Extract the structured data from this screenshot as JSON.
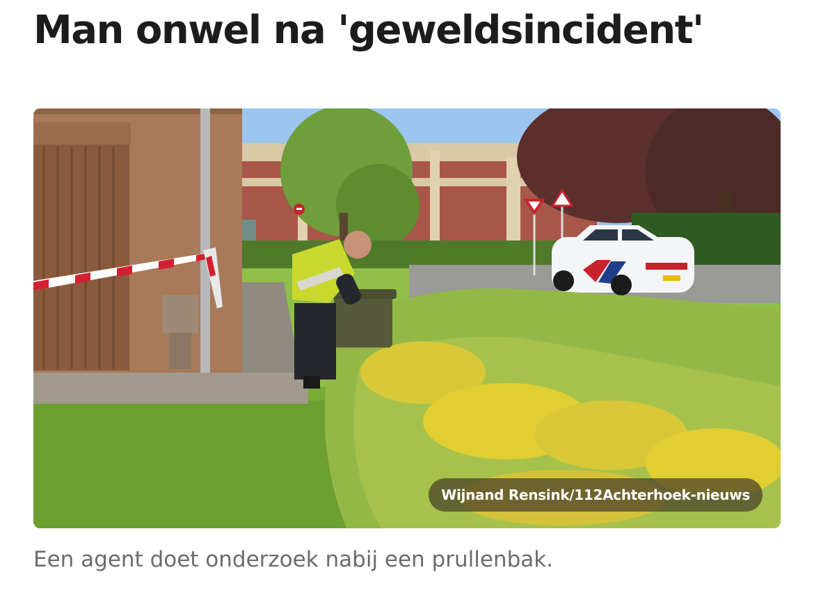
{
  "article": {
    "headline": "Man onwel na 'geweldsincident'",
    "photo": {
      "subject": "police-officer-at-trash-bin",
      "credit": "Wijnand Rensink/112Achterhoek-nieuws"
    },
    "caption": "Een agent doet onderzoek nabij een prullenbak."
  },
  "colors": {
    "headline": "#1c1c1c",
    "caption": "#6b6b6b",
    "credit_bg": "#463e28",
    "credit_text": "#ffffff"
  }
}
